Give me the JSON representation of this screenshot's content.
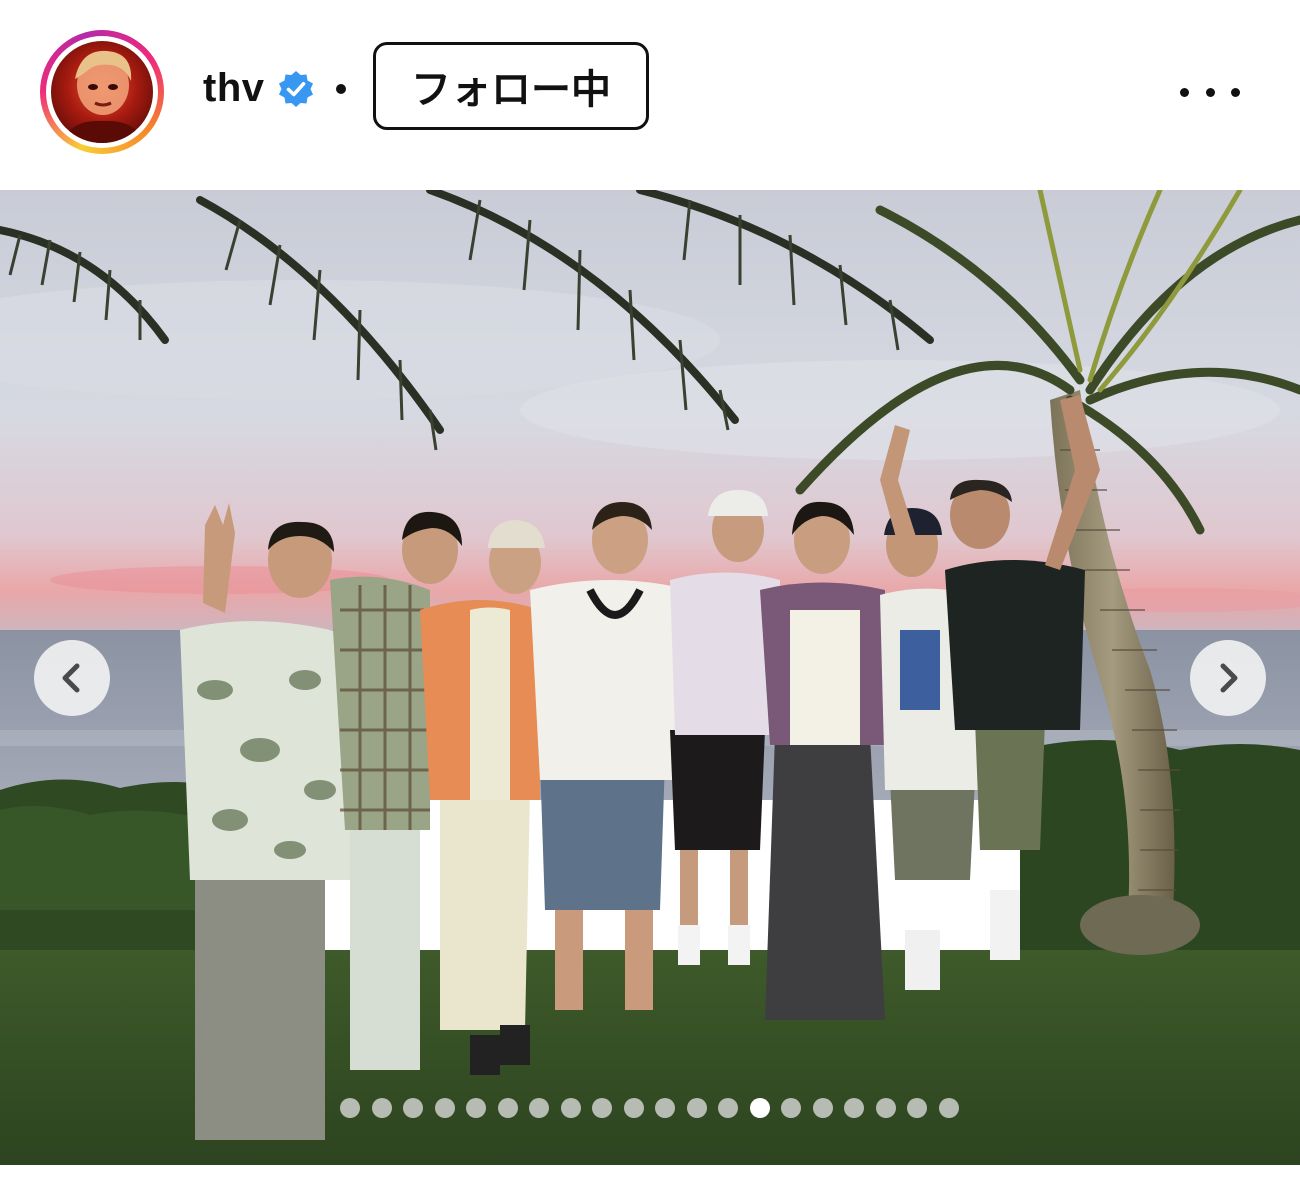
{
  "post": {
    "username": "thv",
    "verified": true,
    "follow_label": "フォロー中",
    "more_icon": "more-horizontal-icon",
    "avatar_icon": "avatar-image"
  },
  "carousel": {
    "total_slides": 20,
    "active_index": 13,
    "prev_icon": "chevron-left-icon",
    "next_icon": "chevron-right-icon"
  },
  "colors": {
    "text": "#111111",
    "verified_blue": "#3897f0",
    "avatar_ring_start": "#f9ce34",
    "avatar_ring_end": "#ee2a7b"
  }
}
